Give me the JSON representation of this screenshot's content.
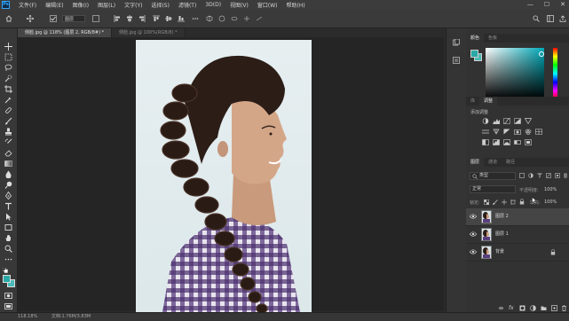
{
  "app": {
    "logo_text": "Ps"
  },
  "menu": {
    "items": [
      "文件(F)",
      "编辑(E)",
      "图像(I)",
      "图层(L)",
      "文字(Y)",
      "选择(S)",
      "滤镜(T)",
      "3D(D)",
      "视图(V)",
      "窗口(W)",
      "帮助(H)"
    ]
  },
  "window_controls": {
    "minimize": "—",
    "maximize": "☐",
    "close": "✕"
  },
  "options_bar": {
    "layer_select_value": "图层"
  },
  "tabs": [
    {
      "label": "侧脸.jpg @ 118% (图层 2, RGB/8#) *"
    },
    {
      "label": "侧脸.jpg @ 100%(RGB/8) *"
    }
  ],
  "status": {
    "zoom": "118.18%",
    "doc_info": "文档:1.76M/3.83M"
  },
  "colors": {
    "foreground": "#29a9a6",
    "background": "#4bbab6",
    "accent": "#31a8ff"
  },
  "color_panel": {
    "tabs": [
      "颜色",
      "色板"
    ]
  },
  "adjustments_panel": {
    "tabs": [
      "库",
      "调整"
    ],
    "add_label": "添加调整"
  },
  "layers_panel": {
    "tabs": [
      "图层",
      "通道",
      "路径"
    ],
    "filter_kind": "类型",
    "blend_mode": "正常",
    "opacity_label": "不透明度:",
    "opacity_value": "100%",
    "lock_label": "锁定:",
    "fill_label": "填充:",
    "fill_value": "100%",
    "layers": [
      {
        "name": "图层 2",
        "selected": true,
        "locked": false
      },
      {
        "name": "图层 1",
        "selected": false,
        "locked": false
      },
      {
        "name": "背景",
        "selected": false,
        "locked": true
      }
    ]
  }
}
